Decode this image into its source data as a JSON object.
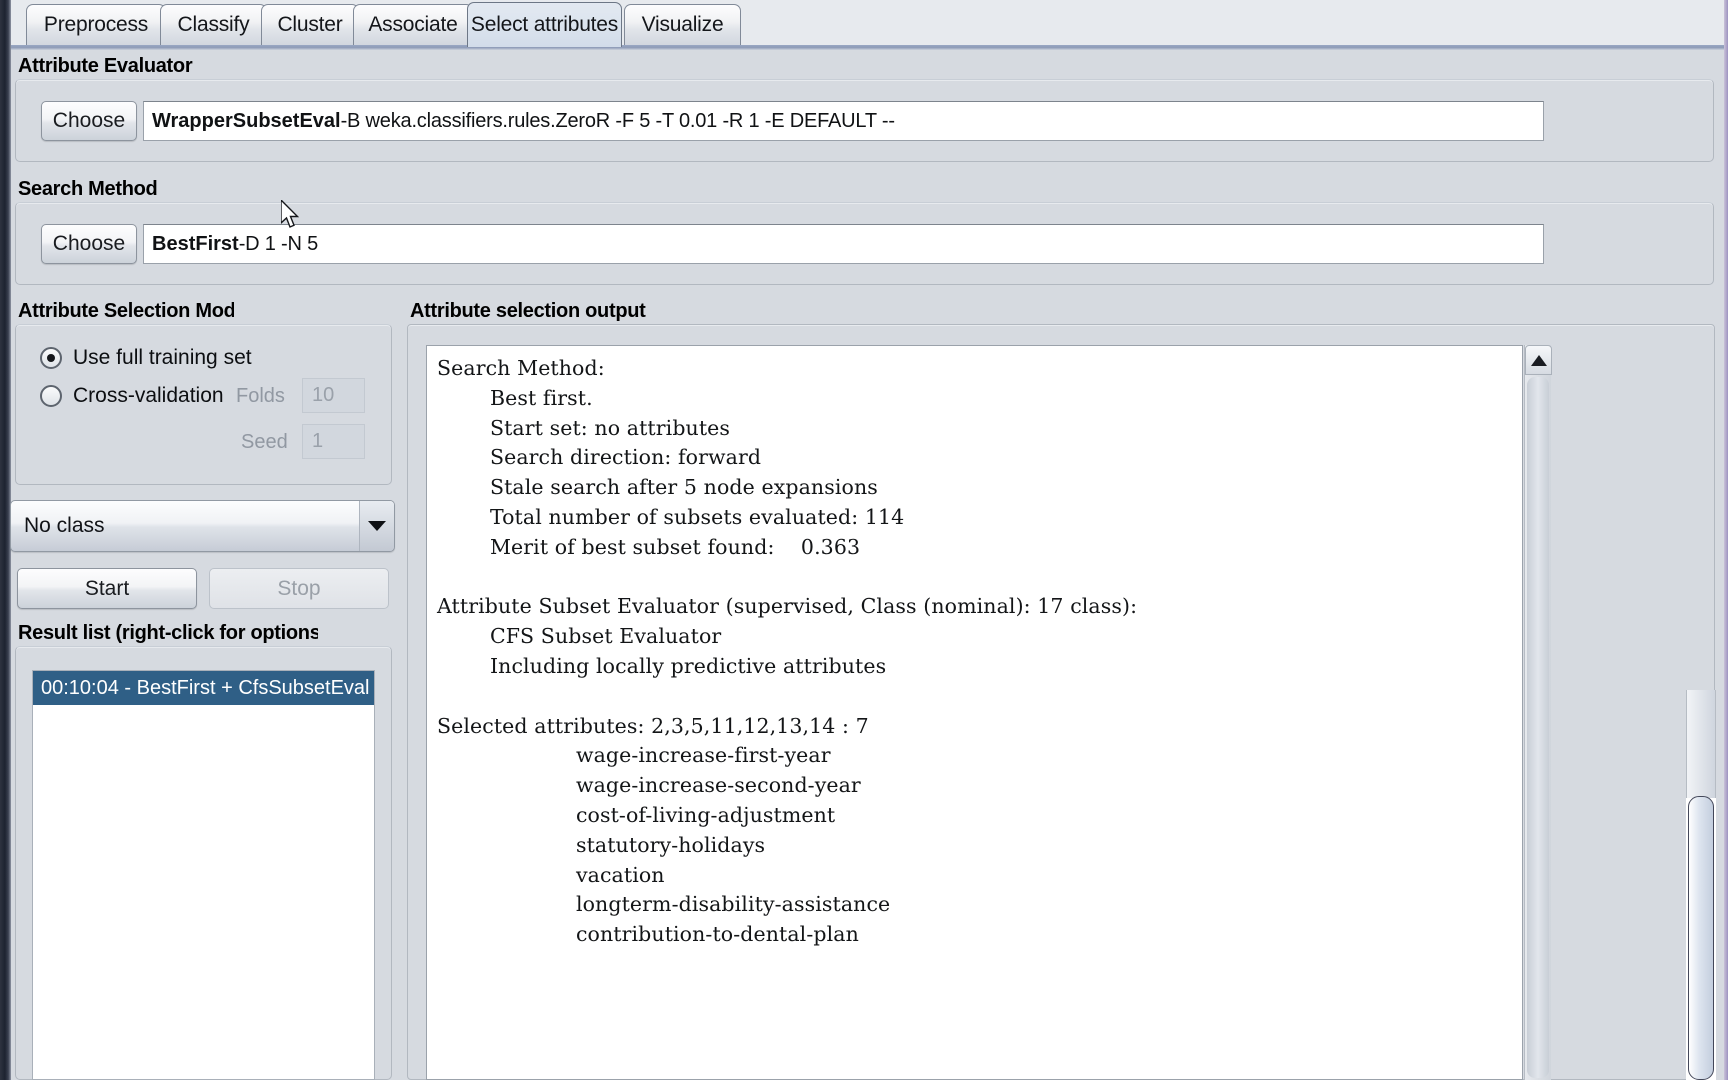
{
  "tabs": [
    {
      "label": "Preprocess",
      "selected": false
    },
    {
      "label": "Classify",
      "selected": false
    },
    {
      "label": "Cluster",
      "selected": false
    },
    {
      "label": "Associate",
      "selected": false
    },
    {
      "label": "Select attributes",
      "selected": true
    },
    {
      "label": "Visualize",
      "selected": false
    }
  ],
  "attribute_evaluator": {
    "section_title": "Attribute Evaluator",
    "choose_label": "Choose",
    "scheme_name": "WrapperSubsetEval",
    "scheme_args": " -B weka.classifiers.rules.ZeroR -F 5 -T 0.01 -R 1 -E DEFAULT --"
  },
  "search_method": {
    "section_title": "Search Method",
    "choose_label": "Choose",
    "scheme_name": "BestFirst",
    "scheme_args": " -D 1 -N 5"
  },
  "selection_mode": {
    "section_title": "Attribute Selection Mode",
    "options": [
      {
        "label": "Use full training set",
        "checked": true
      },
      {
        "label": "Cross-validation",
        "checked": false
      }
    ],
    "folds_label": "Folds",
    "folds_value": "10",
    "seed_label": "Seed",
    "seed_value": "1"
  },
  "class_combo": {
    "selected": "No class"
  },
  "actions": {
    "start_label": "Start",
    "stop_label": "Stop",
    "stop_enabled": false
  },
  "result_list": {
    "section_title": "Result list (right-click for options)",
    "items": [
      {
        "label": "00:10:04 - BestFirst + CfsSubsetEval",
        "selected": true
      }
    ]
  },
  "output": {
    "section_title": "Attribute selection output",
    "text": "Search Method:\n\tBest first.\n\tStart set: no attributes\n\tSearch direction: forward\n\tStale search after 5 node expansions\n\tTotal number of subsets evaluated: 114\n\tMerit of best subset found:    0.363\n\nAttribute Subset Evaluator (supervised, Class (nominal): 17 class):\n\tCFS Subset Evaluator\n\tIncluding locally predictive attributes\n\nSelected attributes: 2,3,5,11,12,13,14 : 7\n                     wage-increase-first-year\n                     wage-increase-second-year\n                     cost-of-living-adjustment\n                     statutory-holidays\n                     vacation\n                     longterm-disability-assistance\n                     contribution-to-dental-plan\n"
  },
  "icons": {
    "scroll_up": "triangle-up-icon",
    "combo_arrow": "chevron-down-icon",
    "mouse_cursor": "mouse-pointer-icon"
  },
  "colors": {
    "selection_blue": "#2f5f86",
    "panel_bg": "#d6dae0",
    "window_chrome": "#e7eaee"
  }
}
